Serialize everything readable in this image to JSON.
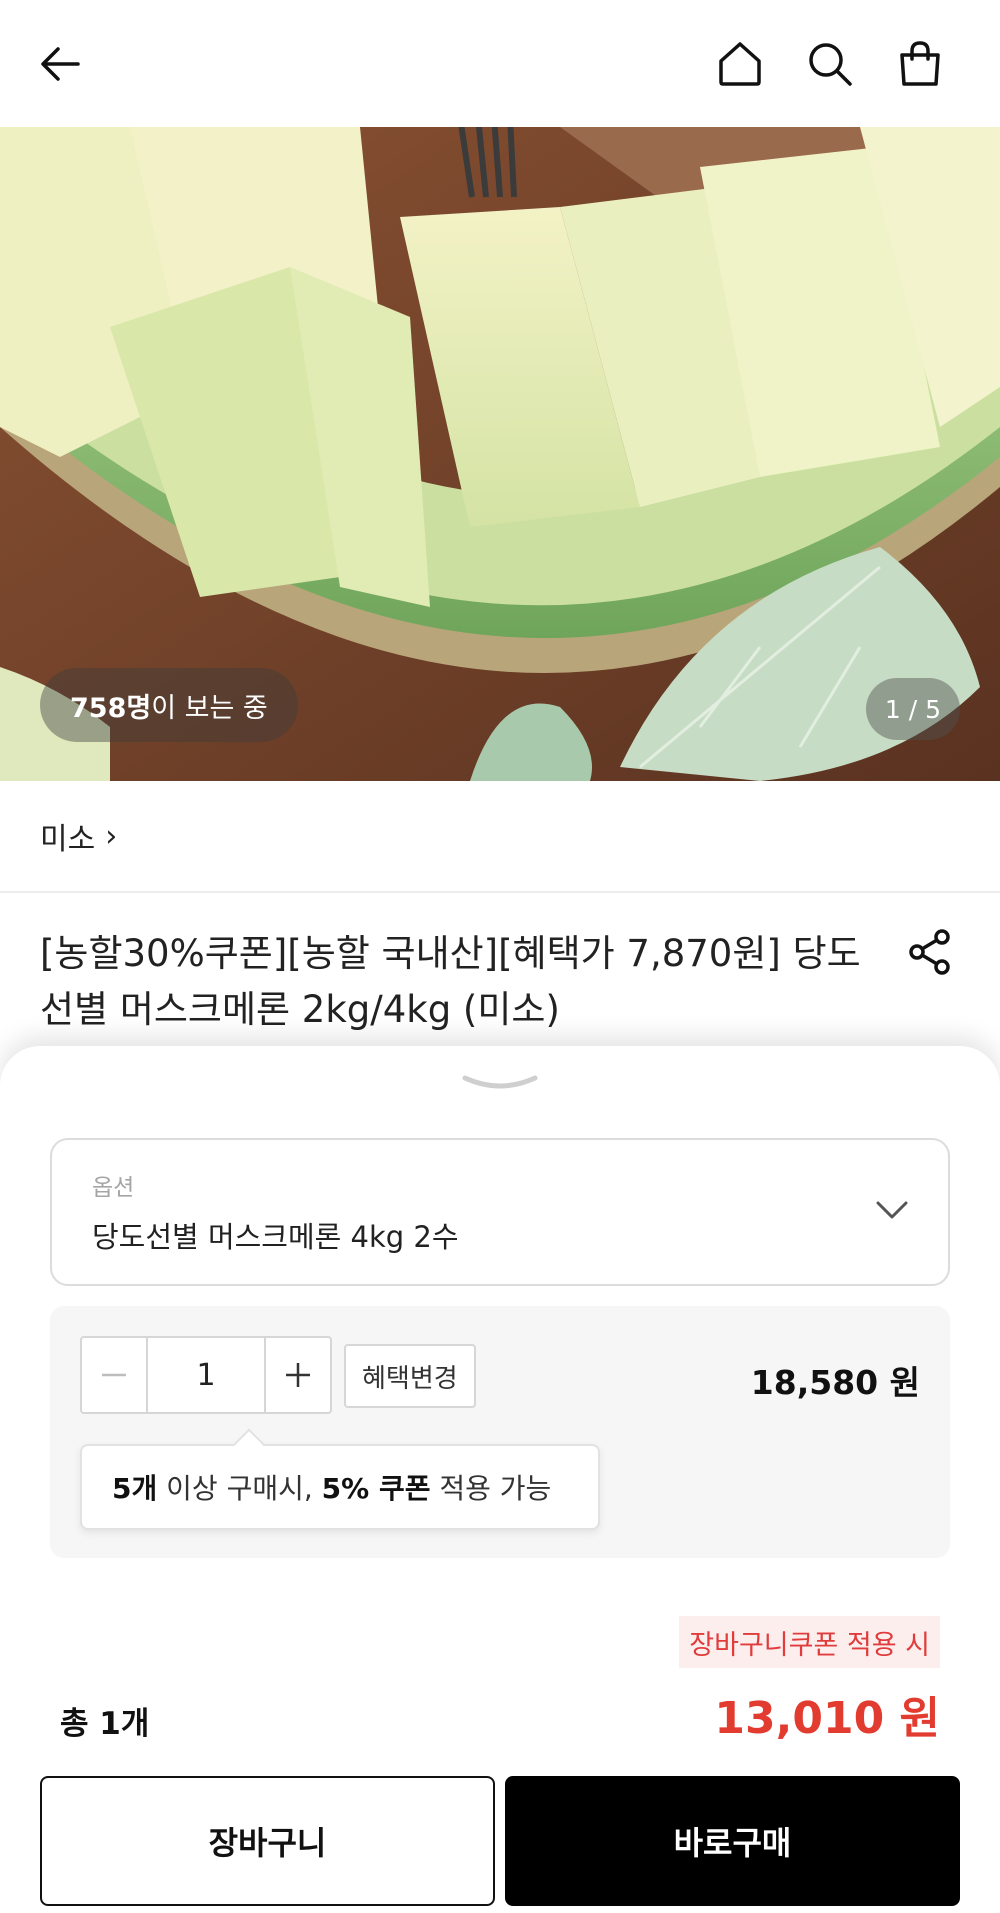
{
  "topbar": {
    "back_icon": "arrow-left-icon",
    "home_icon": "home-icon",
    "search_icon": "search-icon",
    "bag_icon": "shopping-bag-icon"
  },
  "hero": {
    "viewer_count": "758명",
    "viewer_suffix": "이 보는 중",
    "page_indicator": "1 / 5"
  },
  "brand": {
    "name": "미소",
    "chevron": "›"
  },
  "product": {
    "title": "[농할30%쿠폰][농할 국내산][혜택가 7,870원] 당도선별 머스크메론 2kg/4kg (미소)",
    "share_icon": "share-icon"
  },
  "sheet": {
    "handle_icon": "chevron-down-icon",
    "option": {
      "label": "옵션",
      "value": "당도선별 머스크메론 4kg 2수"
    },
    "quantity": {
      "value": "1",
      "benefit_button": "혜택변경",
      "unit_price": "18,580 원"
    },
    "tooltip": {
      "part1": "5개",
      "part2": " 이상 구매시, ",
      "part3": "5% 쿠폰",
      "part4": " 적용 가능"
    },
    "summary": {
      "coupon_tag": "장바구니쿠폰 적용 시",
      "total_count": "총 1개",
      "total_price": "13,010 원"
    },
    "buttons": {
      "cart": "장바구니",
      "buy": "바로구매"
    }
  },
  "colors": {
    "accent_red": "#e23b2f",
    "coupon_bg": "#fdeeee",
    "buy_button": "#000000"
  }
}
